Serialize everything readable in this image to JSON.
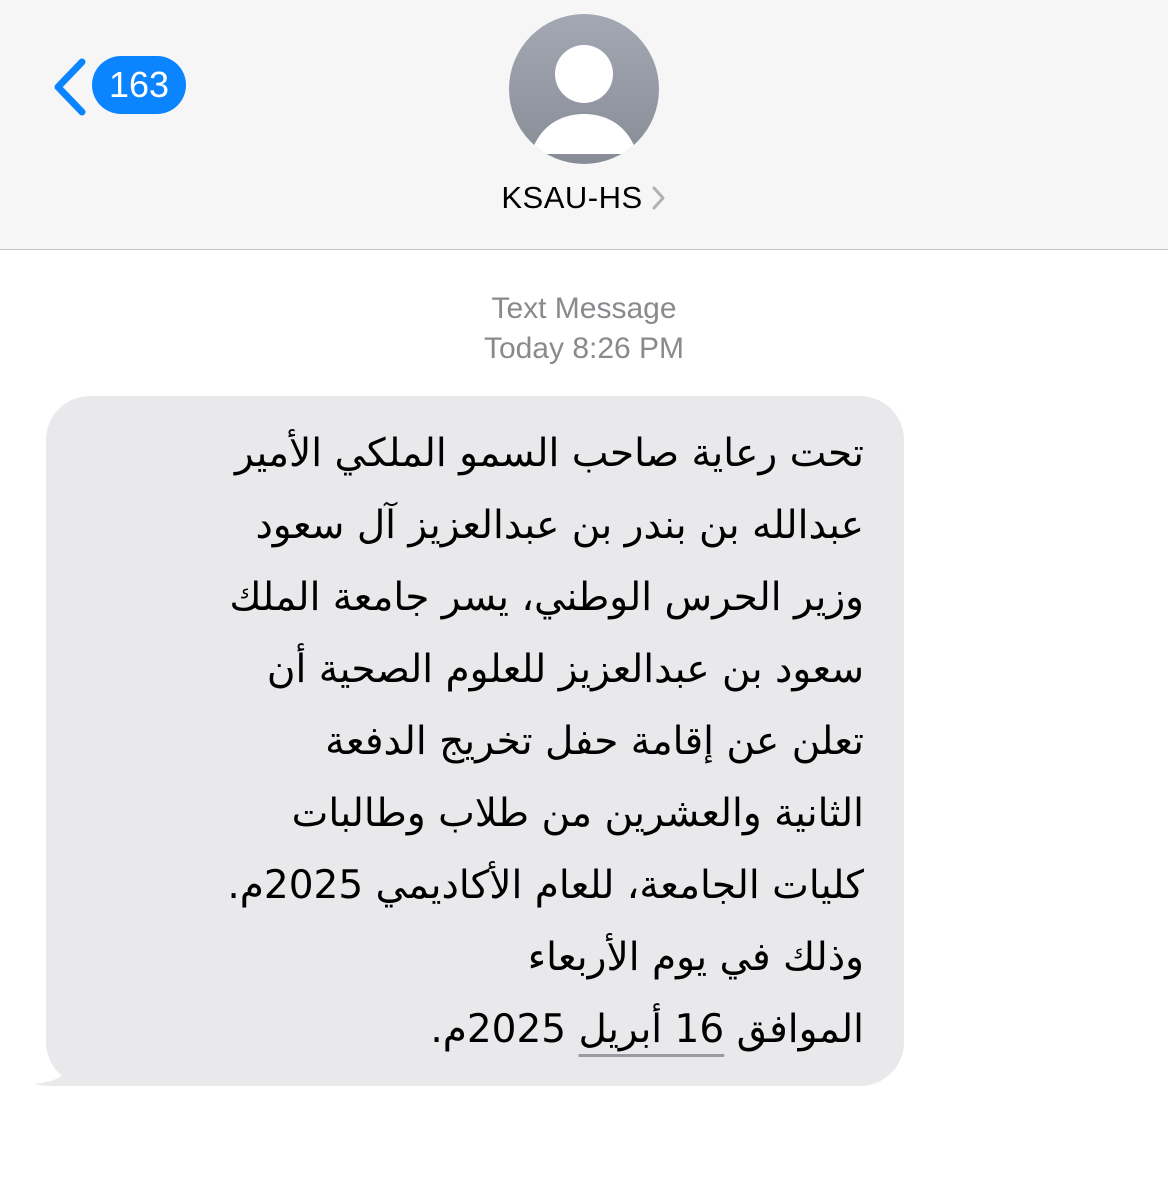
{
  "header": {
    "back_badge": "163",
    "contact_name": "KSAU-HS",
    "icons": {
      "back": "chevron-left-icon",
      "avatar": "person-silhouette-icon",
      "disclosure": "chevron-right-icon"
    },
    "accent_color": "#0a84ff"
  },
  "thread": {
    "message_type": "Text Message",
    "timestamp": "Today 8:26 PM"
  },
  "message": {
    "lines": [
      "تحت رعاية صاحب السمو الملكي الأمير",
      "عبدالله بن بندر بن عبدالعزيز آل سعود",
      "وزير الحرس الوطني، يسر جامعة الملك",
      "سعود بن عبدالعزيز للعلوم الصحية أن",
      "تعلن عن إقامة حفل تخريج الدفعة",
      "الثانية والعشرين من طلاب وطالبات",
      "كليات الجامعة، للعام الأكاديمي 2025م.",
      "وذلك في يوم الأربعاء"
    ],
    "last_line_prefix": "الموافق ",
    "date_link": "16 أبريل",
    "last_line_suffix": " 2025م."
  }
}
